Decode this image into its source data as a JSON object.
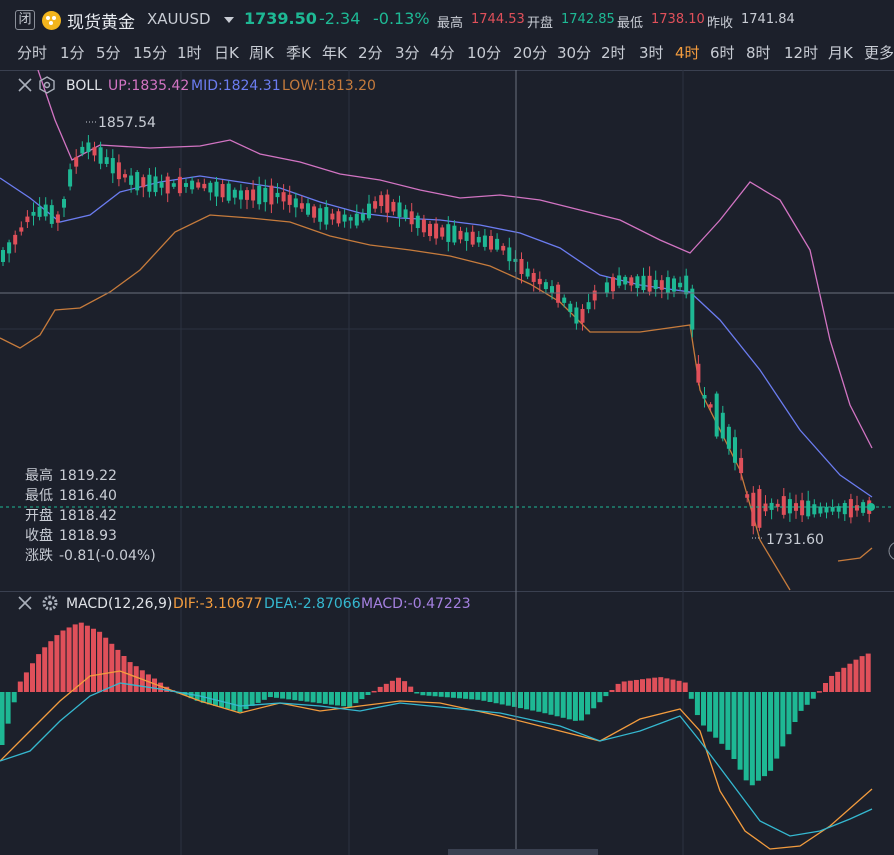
{
  "header": {
    "closed_badge": "闭",
    "name": "现货黄金",
    "code": "XAUUSD",
    "price": "1739.50",
    "change": "-2.34",
    "change_pct": "-0.13%",
    "high_label": "最高",
    "high": "1744.53",
    "open_label": "开盘",
    "open": "1742.85",
    "low_label": "最低",
    "low": "1738.10",
    "prev_close_label": "昨收",
    "prev_close": "1741.84"
  },
  "periods": [
    "分时",
    "1分",
    "5分",
    "15分",
    "1时",
    "日K",
    "周K",
    "季K",
    "年K",
    "2分",
    "3分",
    "4分",
    "10分",
    "20分",
    "30分",
    "2时",
    "3时",
    "4时",
    "6时",
    "8时",
    "12时",
    "月K",
    "更多"
  ],
  "active_period": "4时",
  "boll": {
    "name": "BOLL",
    "up": "UP:1835.42",
    "mid": "MID:1824.31",
    "low": "LOW:1813.20",
    "colors": {
      "up": "#d274c3",
      "mid": "#6b7cf0",
      "low": "#c67b3c"
    }
  },
  "price_marks": {
    "high": "1857.54",
    "low": "1731.60"
  },
  "info_box": {
    "rows": [
      {
        "label": "最高",
        "value": "1819.22"
      },
      {
        "label": "最低",
        "value": "1816.40"
      },
      {
        "label": "开盘",
        "value": "1818.42"
      },
      {
        "label": "收盘",
        "value": "1818.93"
      },
      {
        "label": "涨跌",
        "value": "-0.81(-0.04%)"
      }
    ]
  },
  "macd": {
    "name": "MACD(12,26,9)",
    "dif": "DIF:-3.10677",
    "dea": "DEA:-2.87066",
    "macd": "MACD:-0.47223",
    "colors": {
      "dif": "#f39c3e",
      "dea": "#35b8d0",
      "macd": "#a480e0"
    }
  },
  "colors": {
    "up": "#e0505a",
    "down": "#1eb894",
    "background": "#1c202b",
    "grid": "#2c3240"
  }
}
